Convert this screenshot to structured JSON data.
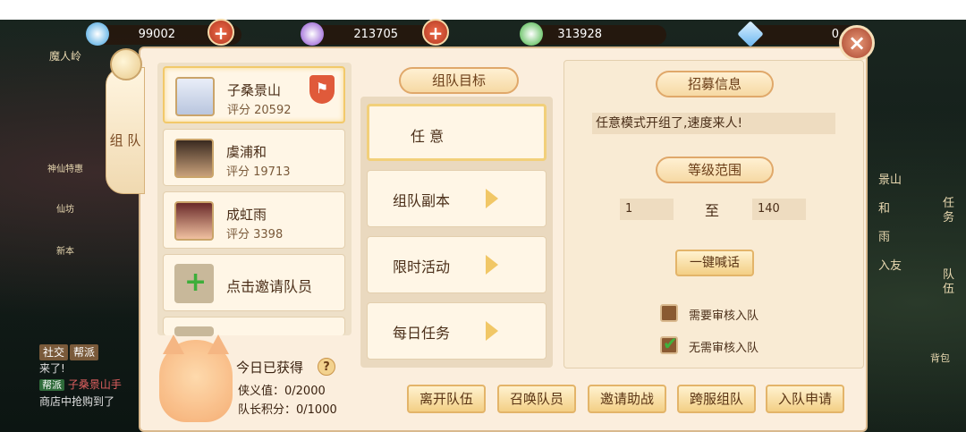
{
  "resources": [
    {
      "icon": "blue-orb-icon",
      "value": "99002",
      "color": "#3aa0e0"
    },
    {
      "icon": "purple-orb-icon",
      "value": "213705",
      "color": "#8a4ad0"
    },
    {
      "icon": "green-orb-icon",
      "value": "313928",
      "color": "#3fb23c"
    },
    {
      "icon": "diamond-icon",
      "value": "0",
      "color": "#6ab6f0"
    }
  ],
  "plus_label": "+",
  "close_label": "×",
  "side_tab": {
    "label": "组 队"
  },
  "members": [
    {
      "name": "子桑景山",
      "score": "评分 20592",
      "flag": "⚑"
    },
    {
      "name": "虞浦和",
      "score": "评分 19713"
    },
    {
      "name": "成虹雨",
      "score": "评分 3398"
    }
  ],
  "invite_label": "点击邀请队员",
  "invite_plus": "+",
  "target_title": "组队目标",
  "targets": [
    {
      "label": "任 意"
    },
    {
      "label": "组队副本"
    },
    {
      "label": "限时活动"
    },
    {
      "label": "每日任务"
    }
  ],
  "recruit": {
    "title": "招募信息",
    "text": "任意模式开组了,速度来人!",
    "level_title": "等级范围",
    "level_min": "1",
    "level_to": "至",
    "level_max": "140",
    "shout_label": "一键喊话",
    "need_review": "需要审核入队",
    "no_review": "无需审核入队",
    "check_mark": "✔"
  },
  "today": {
    "title": "今日已获得",
    "help": "?",
    "honor": "侠义值：0/2000",
    "leader": "队长积分：0/1000"
  },
  "buttons": [
    "离开队伍",
    "召唤队员",
    "邀请助战",
    "跨服组队",
    "入队申请"
  ],
  "left_side": [
    "魔人岭",
    "神仙特惠",
    "仙坊",
    "新本"
  ],
  "right_side": [
    "景山",
    "和",
    "雨",
    "入友",
    "任务",
    "队伍",
    "背包"
  ],
  "chat": {
    "tabs": [
      "社交",
      "帮派"
    ],
    "line1": "来了!",
    "channel": "帮派",
    "name": "子桑景山手",
    "line3": "商店中抢购到了"
  }
}
